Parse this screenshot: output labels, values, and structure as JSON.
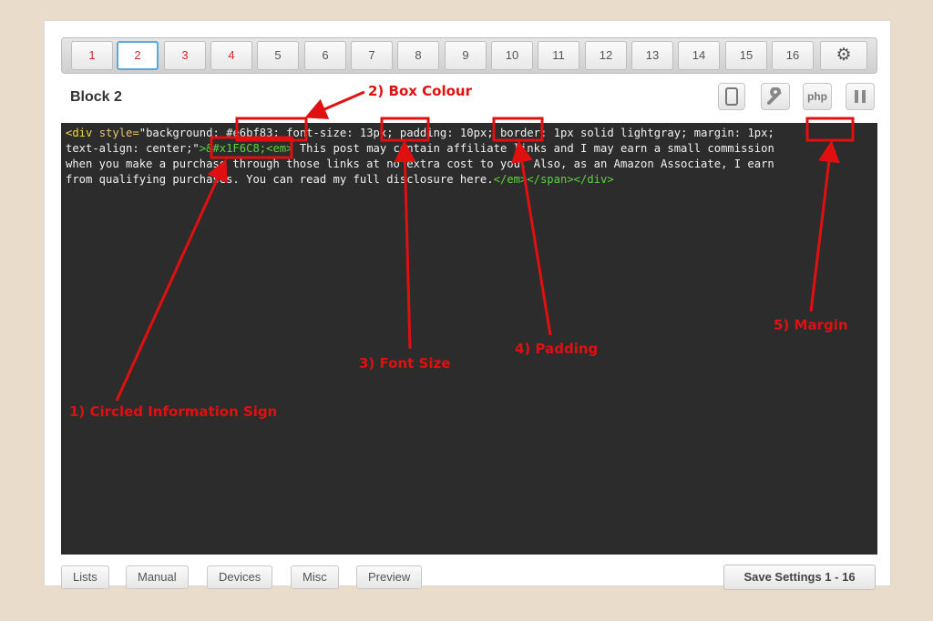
{
  "tabs": [
    {
      "label": "1",
      "state": "red"
    },
    {
      "label": "2",
      "state": "active"
    },
    {
      "label": "3",
      "state": "red"
    },
    {
      "label": "4",
      "state": "red"
    },
    {
      "label": "5",
      "state": ""
    },
    {
      "label": "6",
      "state": ""
    },
    {
      "label": "7",
      "state": ""
    },
    {
      "label": "8",
      "state": ""
    },
    {
      "label": "9",
      "state": ""
    },
    {
      "label": "10",
      "state": ""
    },
    {
      "label": "11",
      "state": ""
    },
    {
      "label": "12",
      "state": ""
    },
    {
      "label": "13",
      "state": ""
    },
    {
      "label": "14",
      "state": ""
    },
    {
      "label": "15",
      "state": ""
    },
    {
      "label": "16",
      "state": ""
    }
  ],
  "settings_icon": "gear-icon",
  "block_title": "Block 2",
  "tools": {
    "device_icon": "tablet-icon",
    "wrench_icon": "wrench-icon",
    "php_label": "php",
    "pause_icon": "pause-icon"
  },
  "code": {
    "l1_open": "<div",
    "l1_style_attr": " style=",
    "l1_text": "\"background: #e6bf83; font-size: 13px; padding: 10px; border: 1px solid lightgray; margin: 1px;",
    "l2_text": "text-align: center;\"",
    "l2_green": ">&#x1F6C8;<em>",
    "l2_rest": " This post may contain affiliate links and I may earn a small commission",
    "l3_text": "when you make a purchase through those links at no extra cost to you. Also, as an Amazon Associate, I earn",
    "l4_text": "from qualifying purchases. You can read my full disclosure here.",
    "l4_green": "</em></span></div>"
  },
  "annotations": {
    "a1": "1) Circled Information Sign",
    "a2": "2) Box Colour",
    "a3": "3) Font Size",
    "a4": "4) Padding",
    "a5": "5) Margin"
  },
  "annotation_color": "#e01010",
  "bottom_buttons": [
    "Lists",
    "Manual",
    "Devices",
    "Misc",
    "Preview"
  ],
  "save_label": "Save Settings 1 - 16"
}
